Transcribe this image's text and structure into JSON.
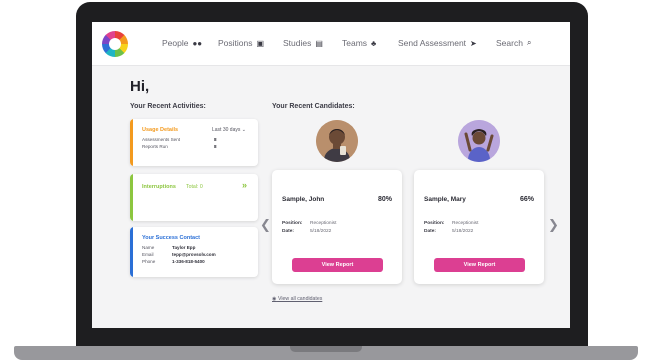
{
  "nav": {
    "items": [
      {
        "label": "People",
        "icon": "people-icon",
        "glyph": "●●"
      },
      {
        "label": "Positions",
        "icon": "positions-icon",
        "glyph": "▣"
      },
      {
        "label": "Studies",
        "icon": "studies-icon",
        "glyph": "▤"
      },
      {
        "label": "Teams",
        "icon": "teams-icon",
        "glyph": "♣"
      },
      {
        "label": "Send Assessment",
        "icon": "send-icon",
        "glyph": "➤"
      },
      {
        "label": "Search",
        "icon": "search-icon",
        "glyph": "⌕"
      }
    ]
  },
  "greeting": "Hi,",
  "activities": {
    "title": "Your Recent Activities:",
    "usage": {
      "title": "Usage Details",
      "period": "Last 30 days",
      "period_icon": "chevron-down-icon",
      "rows": [
        {
          "label": "Assessments Sent",
          "value": "8"
        },
        {
          "label": "Reports Run",
          "value": "8"
        }
      ],
      "accent": "#f39a1e"
    },
    "interruptions": {
      "title": "Interruptions",
      "total": "Total: 0",
      "icon": "double-chevron-right-icon",
      "accent": "#8cc63f"
    },
    "contact": {
      "title": "Your Success Contact",
      "rows": [
        {
          "label": "Name",
          "value": "Taylor Epp"
        },
        {
          "label": "Email",
          "value": "tepp@provsolv.com"
        },
        {
          "label": "Phone",
          "value": "1-336-818-5400"
        }
      ],
      "accent": "#2a6fd6"
    }
  },
  "candidates": {
    "title": "Your Recent Candidates:",
    "items": [
      {
        "name": "Sample, John",
        "score": "80%",
        "position_label": "Position:",
        "position": "Receptionist",
        "date_label": "Date:",
        "date": "5/18/2022",
        "button": "View Report"
      },
      {
        "name": "Sample, Mary",
        "score": "66%",
        "position_label": "Position:",
        "position": "Receptionist",
        "date_label": "Date:",
        "date": "5/18/2022",
        "button": "View Report"
      }
    ],
    "view_all": "View all candidates"
  },
  "colors": {
    "brand_pink": "#dc3f92",
    "usage_orange": "#f39a1e",
    "interrupt_green": "#8cc63f",
    "contact_blue": "#2a6fd6"
  }
}
